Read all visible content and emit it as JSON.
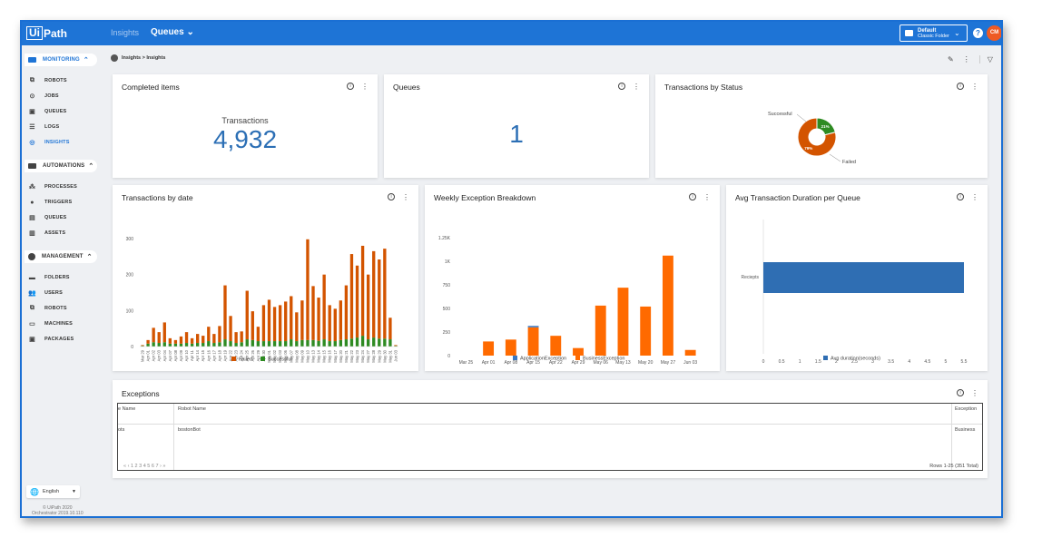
{
  "topbar": {
    "logo_ui": "Ui",
    "logo_path": "Path",
    "nav_insights": "Insights",
    "nav_queues": "Queues",
    "folder_title": "Default",
    "folder_sub": "Classic Folder",
    "help": "?",
    "avatar": "CM"
  },
  "sidebar": {
    "monitoring": "MONITORING",
    "monitoring_items": [
      {
        "label": "ROBOTS",
        "icon": "robot-icon"
      },
      {
        "label": "JOBS",
        "icon": "play-circle-icon"
      },
      {
        "label": "QUEUES",
        "icon": "queue-icon"
      },
      {
        "label": "LOGS",
        "icon": "list-icon"
      },
      {
        "label": "INSIGHTS",
        "icon": "insights-icon"
      }
    ],
    "automations": "AUTOMATIONS",
    "automations_items": [
      {
        "label": "PROCESSES",
        "icon": "process-icon"
      },
      {
        "label": "TRIGGERS",
        "icon": "trigger-icon"
      },
      {
        "label": "QUEUES",
        "icon": "queue-icon"
      },
      {
        "label": "ASSETS",
        "icon": "asset-icon"
      }
    ],
    "management": "MANAGEMENT",
    "management_items": [
      {
        "label": "FOLDERS",
        "icon": "folder-icon"
      },
      {
        "label": "USERS",
        "icon": "users-icon"
      },
      {
        "label": "ROBOTS",
        "icon": "robot-icon"
      },
      {
        "label": "MACHINES",
        "icon": "monitor-icon"
      },
      {
        "label": "PACKAGES",
        "icon": "package-icon"
      }
    ],
    "language": "English",
    "copyright_line1": "© UiPath 2020",
    "copyright_line2": "Orchestrator 2019.10.110"
  },
  "breadcrumb": "Insights > Insights",
  "cards": {
    "completed": {
      "title": "Completed items",
      "label": "Transactions",
      "value": "4,932"
    },
    "queues": {
      "title": "Queues",
      "value": "1"
    },
    "status": {
      "title": "Transactions by Status"
    },
    "by_date": {
      "title": "Transactions by date"
    },
    "weekly": {
      "title": "Weekly Exception Breakdown"
    },
    "avg": {
      "title": "Avg Transaction Duration per Queue"
    },
    "exceptions": {
      "title": "Exceptions",
      "col1": "e Name",
      "col2": "Robot Name",
      "col3": "Exception",
      "row_col1": "ots",
      "row_col2": "bostonBot",
      "row_col3": "Business",
      "pager": "« ‹ 1 2 3 4 5 6 7 › »",
      "rows_info": "Rows 1-25 (351 Total)"
    }
  },
  "colors": {
    "accent": "#1e74d6",
    "failed": "#d35400",
    "successful": "#2e8b22",
    "business": "#ff6a00",
    "application": "#3a78c2",
    "avg_bar": "#2f6eb3"
  },
  "chart_data": [
    {
      "type": "pie",
      "title": "Transactions by Status",
      "labels": [
        "Successful",
        "Failed"
      ],
      "values": [
        21,
        79
      ],
      "slice_labels": [
        "21%",
        "79%"
      ]
    },
    {
      "type": "bar",
      "title": "Transactions by date",
      "stacked": true,
      "categories": [
        "Mar 29",
        "Apr 01",
        "Apr 02",
        "Apr 03",
        "Apr 04",
        "Apr 07",
        "Apr 08",
        "Apr 09",
        "Apr 10",
        "Apr 11",
        "Apr 14",
        "Apr 15",
        "Apr 16",
        "Apr 17",
        "Apr 18",
        "Apr 19",
        "Apr 22",
        "Apr 23",
        "Apr 24",
        "Apr 25",
        "Apr 26",
        "Apr 29",
        "Apr 30",
        "May 01",
        "May 02",
        "May 03",
        "May 06",
        "May 07",
        "May 08",
        "May 09",
        "May 10",
        "May 13",
        "May 14",
        "May 15",
        "May 16",
        "May 17",
        "May 20",
        "May 21",
        "May 22",
        "May 23",
        "May 24",
        "May 27",
        "May 28",
        "May 29",
        "May 30",
        "May 31",
        "Jun 03"
      ],
      "categories_shown": [
        "Mar 29",
        "Apr 01",
        "Apr 02",
        "Apr 03",
        "Apr 04",
        "Apr 07",
        "Apr 08",
        "Apr 09",
        "Apr 10",
        "Apr 11",
        "Apr 14",
        "Apr 15",
        "Apr 16",
        "Apr 17",
        "Apr 18",
        "Apr 19",
        "Apr 22",
        "Apr 23",
        "Apr 24",
        "Apr 25",
        "Apr 26",
        "Apr 29",
        "Apr 30",
        "May 01",
        "May 02",
        "May 03",
        "May 06",
        "May 07",
        "May 08",
        "May 09",
        "May 10",
        "May 13",
        "May 14",
        "May 15",
        "May 16",
        "May 17",
        "May 20",
        "May 21",
        "May 22",
        "May 23",
        "May 24",
        "May 27",
        "May 28",
        "May 29",
        "May 30",
        "May 31",
        "Jun 03"
      ],
      "series": [
        {
          "name": "Failed",
          "values": [
            2,
            10,
            40,
            30,
            55,
            15,
            10,
            20,
            30,
            15,
            25,
            20,
            40,
            25,
            45,
            150,
            70,
            30,
            30,
            135,
            80,
            40,
            100,
            115,
            95,
            100,
            110,
            120,
            80,
            110,
            280,
            150,
            120,
            180,
            100,
            90,
            110,
            150,
            235,
            200,
            250,
            180,
            240,
            220,
            250,
            60,
            2
          ]
        },
        {
          "name": "Successful",
          "values": [
            2,
            8,
            12,
            10,
            12,
            8,
            8,
            8,
            10,
            8,
            10,
            10,
            15,
            10,
            12,
            20,
            15,
            10,
            12,
            20,
            18,
            15,
            15,
            15,
            15,
            15,
            15,
            20,
            15,
            18,
            18,
            18,
            16,
            20,
            15,
            15,
            18,
            20,
            22,
            25,
            30,
            20,
            25,
            22,
            22,
            20,
            2
          ]
        }
      ],
      "ylim": [
        0,
        300
      ],
      "yticks": [
        0,
        100,
        200,
        300
      ],
      "legend": "bottom"
    },
    {
      "type": "bar",
      "title": "Weekly Exception Breakdown",
      "stacked": true,
      "categories": [
        "Mar 25",
        "Apr 01",
        "Apr 08",
        "Apr 15",
        "Apr 22",
        "Apr 29",
        "May 06",
        "May 13",
        "May 20",
        "May 27",
        "Jun 03"
      ],
      "series": [
        {
          "name": "ApplicationException",
          "values": [
            0,
            0,
            0,
            15,
            0,
            0,
            0,
            0,
            0,
            0,
            0
          ]
        },
        {
          "name": "BusinessException",
          "values": [
            0,
            150,
            170,
            300,
            210,
            80,
            530,
            720,
            520,
            1060,
            60
          ]
        }
      ],
      "ylim": [
        0,
        1250
      ],
      "ytick_labels": [
        "0",
        "250",
        "500",
        "750",
        "1K",
        "1.25K"
      ],
      "legend": "bottom"
    },
    {
      "type": "bar",
      "orientation": "horizontal",
      "title": "Avg Transaction Duration per Queue",
      "categories": [
        "Reciepts"
      ],
      "series": [
        {
          "name": "Avg duration(seconds)",
          "values": [
            5.5
          ]
        }
      ],
      "xlim": [
        0,
        5.5
      ],
      "xtick_labels": [
        "0",
        "0.5",
        "1",
        "1.5",
        "2",
        "2.5",
        "3",
        "3.5",
        "4",
        "4.5",
        "5",
        "5.5"
      ],
      "legend": "bottom"
    }
  ]
}
